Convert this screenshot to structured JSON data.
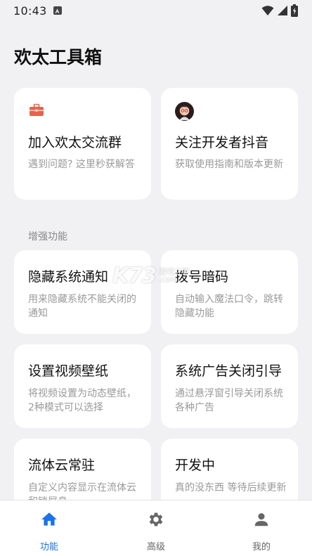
{
  "status_bar": {
    "time": "10:43"
  },
  "app": {
    "title": "欢太工具箱"
  },
  "top_cards": [
    {
      "icon": "toolbox-icon",
      "title": "加入欢太交流群",
      "desc": "遇到问题? 这里秒获解答"
    },
    {
      "icon": "avatar-icon",
      "title": "关注开发者抖音",
      "desc": "获取使用指南和版本更新"
    }
  ],
  "section": {
    "label": "增强功能"
  },
  "feature_cards": [
    {
      "title": "隐藏系统通知",
      "desc": "用来隐藏系统不能关闭的通知"
    },
    {
      "title": "拨号暗码",
      "desc": "自动输入魔法口令，跳转隐藏功能"
    },
    {
      "title": "设置视频壁纸",
      "desc": "将视频设置为动态壁纸，2种模式可以选择"
    },
    {
      "title": "系统广告关闭引导",
      "desc": "通过悬浮窗引导关闭系统各种广告"
    },
    {
      "title": "流体云常驻",
      "desc": "自定义内容显示在流体云和锁屏息"
    },
    {
      "title": "开发中",
      "desc": "真的没东西 等待后续更新"
    }
  ],
  "watermark": {
    "logo": "K73",
    "line1": "游戏之家",
    "line2": ".com"
  },
  "bottom_nav": {
    "items": [
      {
        "label": "功能",
        "icon": "home-icon",
        "active": true
      },
      {
        "label": "高级",
        "icon": "gear-icon",
        "active": false
      },
      {
        "label": "我的",
        "icon": "person-icon",
        "active": false
      }
    ],
    "active_color": "#1a73e8",
    "inactive_color": "#666666"
  }
}
